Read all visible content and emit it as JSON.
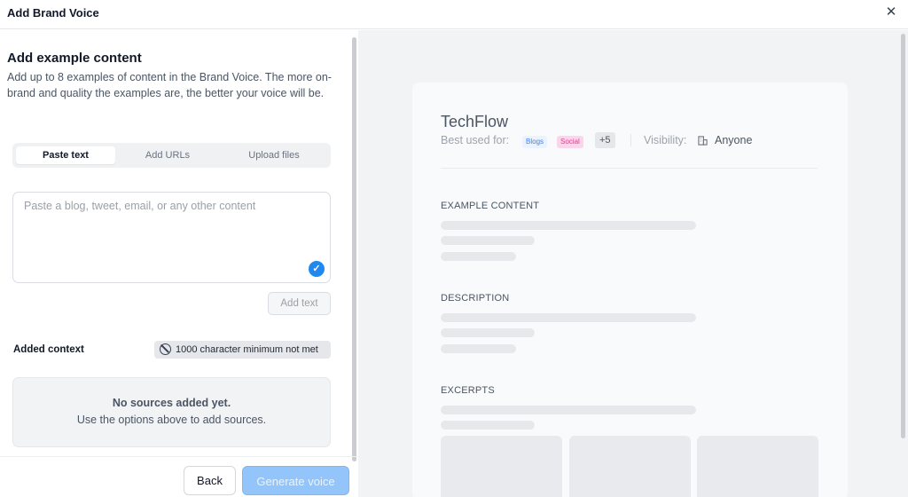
{
  "header": {
    "title": "Add Brand Voice",
    "close_icon": "close-icon"
  },
  "left": {
    "heading": "Add example content",
    "description": "Add up to 8 examples of content in the Brand Voice. The more on-brand and quality the examples are, the better your voice will be.",
    "tabs": [
      {
        "label": "Paste text",
        "active": true
      },
      {
        "label": "Add URLs",
        "active": false
      },
      {
        "label": "Upload files",
        "active": false
      }
    ],
    "textarea_placeholder": "Paste a blog, tweet, email, or any other content",
    "add_text_label": "Add text",
    "added_context_label": "Added context",
    "min_badge": "1000 character minimum not met",
    "empty_title": "No sources added yet.",
    "empty_subtitle": "Use the options above to add sources.",
    "back_label": "Back",
    "generate_label": "Generate voice"
  },
  "preview": {
    "brand_name": "TechFlow",
    "best_used_for_label": "Best used for:",
    "tags": [
      "Blogs",
      "Social"
    ],
    "more_tags": "+5",
    "visibility_label": "Visibility:",
    "visibility_value": "Anyone",
    "sections": [
      "EXAMPLE CONTENT",
      "DESCRIPTION",
      "EXCERPTS"
    ]
  },
  "colors": {
    "primary_button": "#93c5fb",
    "check_blue": "#2188f0",
    "social_tag": "#fbd5ec",
    "blogs_tag": "#eaf3ff"
  }
}
